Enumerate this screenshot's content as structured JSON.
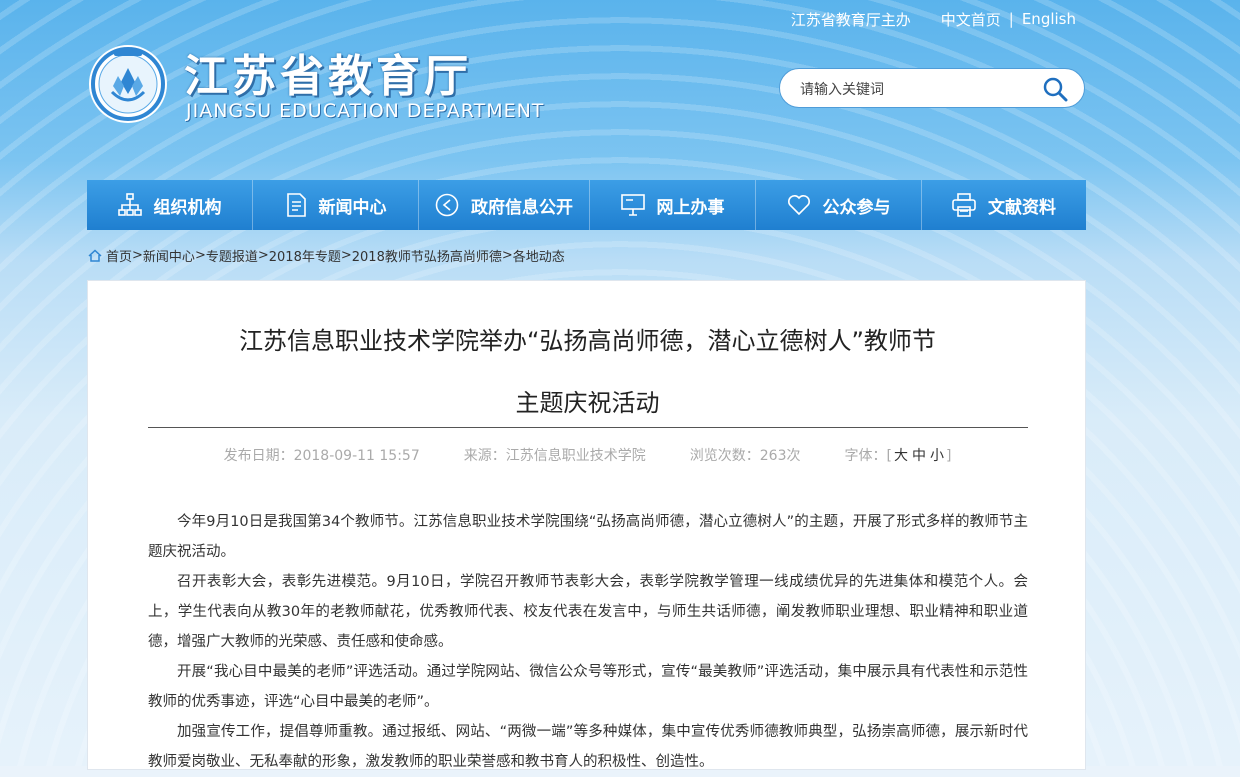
{
  "top": {
    "host": "江苏省教育厅主办",
    "home": "中文首页",
    "sep": "|",
    "english": "English"
  },
  "brand": {
    "cn": "江苏省教育厅",
    "en": "JIANGSU EDUCATION DEPARTMENT"
  },
  "search": {
    "placeholder": "请输入关键词"
  },
  "nav": [
    {
      "label": "组织机构",
      "icon": "org-chart-icon"
    },
    {
      "label": "新闻中心",
      "icon": "document-icon"
    },
    {
      "label": "政府信息公开",
      "icon": "announcement-icon"
    },
    {
      "label": "网上办事",
      "icon": "monitor-icon"
    },
    {
      "label": "公众参与",
      "icon": "heart-icon"
    },
    {
      "label": "文献资料",
      "icon": "printer-icon"
    }
  ],
  "breadcrumb": {
    "items": [
      "首页",
      "新闻中心",
      "专题报道",
      "2018年专题",
      "2018教师节弘扬高尚师德",
      "各地动态"
    ],
    "sep": ">"
  },
  "article": {
    "title_line1": "江苏信息职业技术学院举办“弘扬高尚师德，潜心立德树人”教师节",
    "title_line2": "主题庆祝活动",
    "meta": {
      "date_label": "发布日期：",
      "date": "2018-09-11 15:57",
      "source_label": "来源：",
      "source": "江苏信息职业技术学院",
      "views_label": "浏览次数：",
      "views": "263次",
      "font_label": "字体：",
      "bracket_open": "[",
      "size_large": "大",
      "size_medium": "中",
      "size_small": "小",
      "bracket_close": "]"
    },
    "paragraphs": [
      "今年9月10日是我国第34个教师节。江苏信息职业技术学院围绕“弘扬高尚师德，潜心立德树人”的主题，开展了形式多样的教师节主题庆祝活动。",
      "召开表彰大会，表彰先进模范。9月10日，学院召开教师节表彰大会，表彰学院教学管理一线成绩优异的先进集体和模范个人。会上，学生代表向从教30年的老教师献花，优秀教师代表、校友代表在发言中，与师生共话师德，阐发教师职业理想、职业精神和职业道德，增强广大教师的光荣感、责任感和使命感。",
      "开展“我心目中最美的老师”评选活动。通过学院网站、微信公众号等形式，宣传“最美教师”评选活动，集中展示具有代表性和示范性教师的优秀事迹，评选“心目中最美的老师”。",
      "加强宣传工作，提倡尊师重教。通过报纸、网站、“两微一端”等多种媒体，集中宣传优秀师德教师典型，弘扬崇高师德，展示新时代教师爱岗敬业、无私奉献的形象，激发教师的职业荣誉感和教书育人的积极性、创造性。"
    ]
  }
}
